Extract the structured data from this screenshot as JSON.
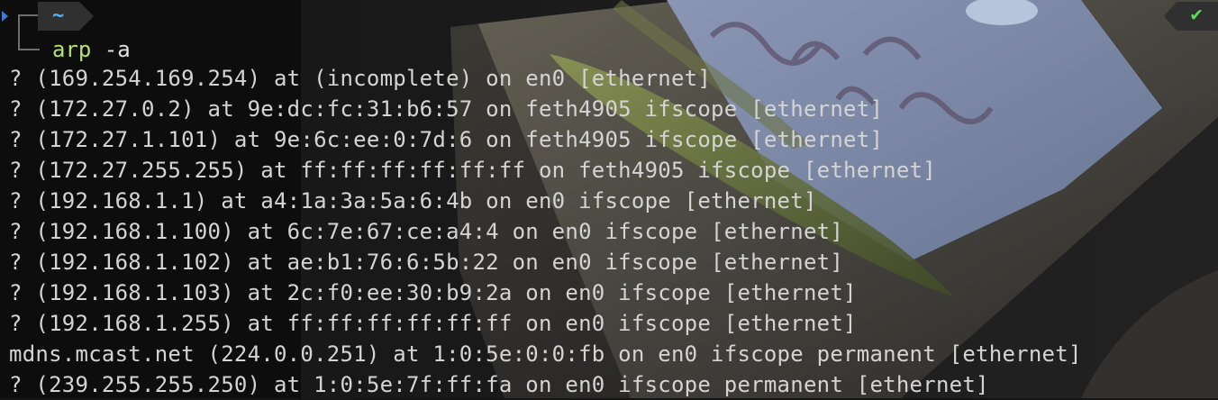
{
  "theme": {
    "background": "#151515",
    "text": "#d4d4d4",
    "command_color": "#b5e06d",
    "dir_color": "#4fb3ff",
    "ok_color": "#5fd75f"
  },
  "prompt": {
    "dir": "~",
    "status_icon": "✔",
    "command": "arp",
    "args": " -a"
  },
  "output_lines": [
    "? (169.254.169.254) at (incomplete) on en0 [ethernet]",
    "? (172.27.0.2) at 9e:dc:fc:31:b6:57 on feth4905 ifscope [ethernet]",
    "? (172.27.1.101) at 9e:6c:ee:0:7d:6 on feth4905 ifscope [ethernet]",
    "? (172.27.255.255) at ff:ff:ff:ff:ff:ff on feth4905 ifscope [ethernet]",
    "? (192.168.1.1) at a4:1a:3a:5a:6:4b on en0 ifscope [ethernet]",
    "? (192.168.1.100) at 6c:7e:67:ce:a4:4 on en0 ifscope [ethernet]",
    "? (192.168.1.102) at ae:b1:76:6:5b:22 on en0 ifscope [ethernet]",
    "? (192.168.1.103) at 2c:f0:ee:30:b9:2a on en0 ifscope [ethernet]",
    "? (192.168.1.255) at ff:ff:ff:ff:ff:ff on en0 ifscope [ethernet]",
    "mdns.mcast.net (224.0.0.251) at 1:0:5e:0:0:fb on en0 ifscope permanent [ethernet]",
    "? (239.255.255.250) at 1:0:5e:7f:ff:fa on en0 ifscope permanent [ethernet]"
  ]
}
